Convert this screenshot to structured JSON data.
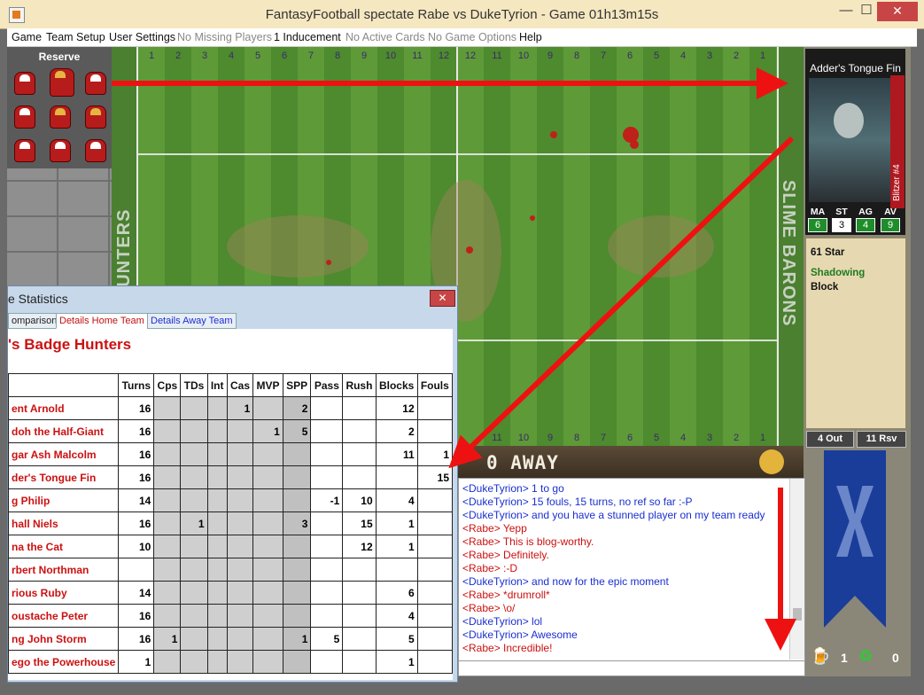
{
  "window": {
    "title": "FantasyFootball spectate Rabe vs DukeTyrion - Game 01h13m15s",
    "min": "—",
    "max": "☐",
    "close": "✕"
  },
  "menu": [
    "Game",
    "Team Setup",
    "User Settings",
    "No Missing Players",
    "1 Inducement",
    "No Active Cards",
    "No Game Options",
    "Help"
  ],
  "reserve": {
    "label": "Reserve"
  },
  "pitch": {
    "top_numbers": [
      "1",
      "2",
      "3",
      "4",
      "5",
      "6",
      "7",
      "8",
      "9",
      "10",
      "11",
      "12",
      "12",
      "11",
      "10",
      "9",
      "8",
      "7",
      "6",
      "5",
      "4",
      "3",
      "2",
      "1"
    ],
    "bottom_numbers": [
      "11",
      "10",
      "9",
      "8",
      "7",
      "6",
      "5",
      "4",
      "3",
      "2",
      "1"
    ],
    "home_team_label": "BADGE HUNTERS",
    "away_team_label": "SLIME BARONS"
  },
  "player_card": {
    "name": "Adder's Tongue Fin",
    "position": "Blitzer #4",
    "stats": [
      {
        "key": "MA",
        "value": "6"
      },
      {
        "key": "ST",
        "value": "3"
      },
      {
        "key": "AG",
        "value": "4"
      },
      {
        "key": "AV",
        "value": "9"
      }
    ],
    "spp": "61 Star",
    "skills": [
      "Shadowing",
      "Block"
    ]
  },
  "team_info": {
    "out": "4 Out",
    "rsv": "11 Rsv"
  },
  "bottom_counts": {
    "rerolls": "1",
    "apothecary": "0"
  },
  "scoreboard": {
    "score": "0 AWAY"
  },
  "chat": {
    "lines": [
      {
        "text": "<DukeTyrion> 1 to go",
        "color": "blue"
      },
      {
        "text": "<DukeTyrion> 15 fouls, 15 turns, no ref so far :-P",
        "color": "blue"
      },
      {
        "text": "<DukeTyrion> and you have a stunned player on my team ready",
        "color": "blue"
      },
      {
        "text": "<Rabe> Yepp",
        "color": "red"
      },
      {
        "text": "<Rabe> This is blog-worthy.",
        "color": "red"
      },
      {
        "text": "<Rabe> Definitely.",
        "color": "red"
      },
      {
        "text": "<Rabe> :-D",
        "color": "red"
      },
      {
        "text": "<DukeTyrion> and now for the epic moment",
        "color": "blue"
      },
      {
        "text": "<Rabe> *drumroll*",
        "color": "red"
      },
      {
        "text": "<Rabe> \\o/",
        "color": "red"
      },
      {
        "text": "<DukeTyrion> lol",
        "color": "blue"
      },
      {
        "text": "<DukeTyrion> Awesome",
        "color": "blue"
      },
      {
        "text": "<Rabe> Incredible!",
        "color": "red"
      }
    ]
  },
  "dialog": {
    "title": "e Statistics",
    "tabs": [
      "omparison",
      "Details Home Team",
      "Details Away Team"
    ],
    "team_name": "'s Badge Hunters",
    "columns": [
      "Turns",
      "Cps",
      "TDs",
      "Int",
      "Cas",
      "MVP",
      "SPP",
      "Pass",
      "Rush",
      "Blocks",
      "Fouls"
    ],
    "rows": [
      {
        "name": "ent Arnold",
        "cells": [
          "16",
          "",
          "",
          "",
          "1",
          "",
          "2",
          "",
          "",
          "12",
          ""
        ]
      },
      {
        "name": "doh the Half-Giant",
        "cells": [
          "16",
          "",
          "",
          "",
          "",
          "1",
          "5",
          "",
          "",
          "2",
          ""
        ]
      },
      {
        "name": "gar Ash Malcolm",
        "cells": [
          "16",
          "",
          "",
          "",
          "",
          "",
          "",
          "",
          "",
          "11",
          "1"
        ]
      },
      {
        "name": "der's Tongue Fin",
        "cells": [
          "16",
          "",
          "",
          "",
          "",
          "",
          "",
          "",
          "",
          "",
          "15"
        ]
      },
      {
        "name": "g Philip",
        "cells": [
          "14",
          "",
          "",
          "",
          "",
          "",
          "",
          "-1",
          "10",
          "4",
          ""
        ]
      },
      {
        "name": "hall Niels",
        "cells": [
          "16",
          "",
          "1",
          "",
          "",
          "",
          "3",
          "",
          "15",
          "1",
          ""
        ]
      },
      {
        "name": "na the Cat",
        "cells": [
          "10",
          "",
          "",
          "",
          "",
          "",
          "",
          "",
          "12",
          "1",
          ""
        ]
      },
      {
        "name": "rbert Northman",
        "cells": [
          "",
          "",
          "",
          "",
          "",
          "",
          "",
          "",
          "",
          "",
          ""
        ]
      },
      {
        "name": "rious Ruby",
        "cells": [
          "14",
          "",
          "",
          "",
          "",
          "",
          "",
          "",
          "",
          "6",
          ""
        ]
      },
      {
        "name": "oustache Peter",
        "cells": [
          "16",
          "",
          "",
          "",
          "",
          "",
          "",
          "",
          "",
          "4",
          ""
        ]
      },
      {
        "name": "ng John Storm",
        "cells": [
          "16",
          "1",
          "",
          "",
          "",
          "",
          "1",
          "5",
          "",
          "5",
          ""
        ]
      },
      {
        "name": "ego the Powerhouse",
        "cells": [
          "1",
          "",
          "",
          "",
          "",
          "",
          "",
          "",
          "",
          "1",
          ""
        ]
      }
    ]
  }
}
